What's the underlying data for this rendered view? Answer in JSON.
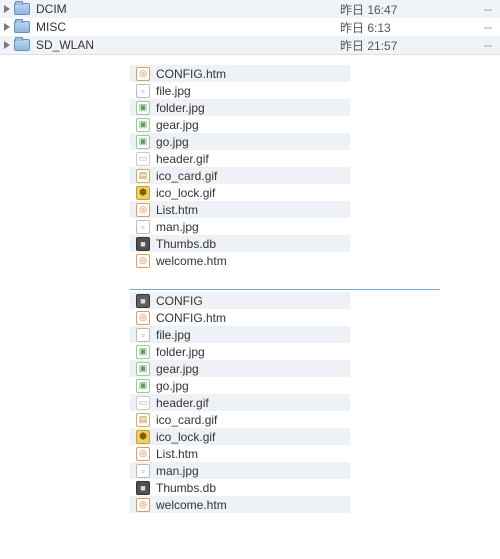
{
  "tree": [
    {
      "name": "DCIM",
      "modified": "昨日 16:47",
      "size": "--"
    },
    {
      "name": "MISC",
      "modified": "昨日 6:13",
      "size": "--"
    },
    {
      "name": "SD_WLAN",
      "modified": "昨日 21:57",
      "size": "--"
    }
  ],
  "list1": [
    {
      "icon": "htm",
      "name": "CONFIG.htm"
    },
    {
      "icon": "jpg",
      "name": "file.jpg"
    },
    {
      "icon": "img",
      "name": "folder.jpg"
    },
    {
      "icon": "img",
      "name": "gear.jpg"
    },
    {
      "icon": "img",
      "name": "go.jpg"
    },
    {
      "icon": "gif",
      "name": "header.gif"
    },
    {
      "icon": "card",
      "name": "ico_card.gif"
    },
    {
      "icon": "lock",
      "name": "ico_lock.gif"
    },
    {
      "icon": "htm",
      "name": "List.htm"
    },
    {
      "icon": "jpg",
      "name": "man.jpg"
    },
    {
      "icon": "db",
      "name": "Thumbs.db"
    },
    {
      "icon": "htm",
      "name": "welcome.htm"
    }
  ],
  "list2": [
    {
      "icon": "folder",
      "name": "CONFIG"
    },
    {
      "icon": "htm",
      "name": "CONFIG.htm"
    },
    {
      "icon": "jpg",
      "name": "file.jpg"
    },
    {
      "icon": "img",
      "name": "folder.jpg"
    },
    {
      "icon": "img",
      "name": "gear.jpg"
    },
    {
      "icon": "img",
      "name": "go.jpg"
    },
    {
      "icon": "gif",
      "name": "header.gif"
    },
    {
      "icon": "card",
      "name": "ico_card.gif"
    },
    {
      "icon": "lock",
      "name": "ico_lock.gif"
    },
    {
      "icon": "htm",
      "name": "List.htm"
    },
    {
      "icon": "jpg",
      "name": "man.jpg"
    },
    {
      "icon": "db",
      "name": "Thumbs.db"
    },
    {
      "icon": "htm",
      "name": "welcome.htm"
    }
  ],
  "glyph": {
    "htm": "◎",
    "jpg": "▫",
    "img": "▣",
    "gif": "▭",
    "card": "▤",
    "lock": "⬢",
    "db": "■",
    "folder": "■"
  }
}
